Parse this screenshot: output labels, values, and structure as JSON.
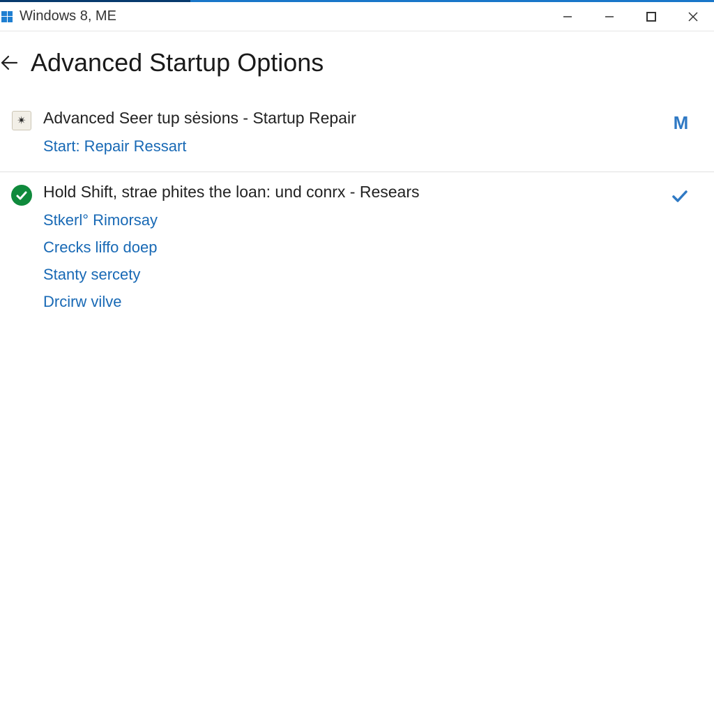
{
  "titlebar": {
    "title": "Windows 8, ME"
  },
  "page": {
    "heading": "Advanced Startup Options"
  },
  "sections": [
    {
      "title": "Advanced Seer tup sėsions - Startup Repair",
      "links": [
        "Start: Repair Ressart"
      ],
      "rightIcon": "M"
    },
    {
      "title": "Hold Shift, strae phites the loan: und conrx - Resears",
      "links": [
        "Stkerl° Rimorsay",
        "Crecks liffo doep",
        "Stanty sercety",
        "Drcirw vilve"
      ],
      "rightIcon": "check"
    }
  ]
}
